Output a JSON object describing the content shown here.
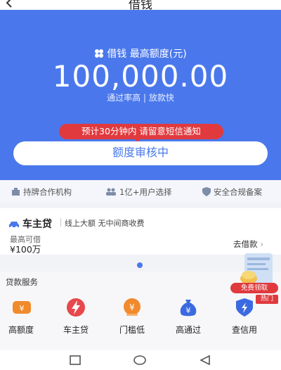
{
  "header": {
    "title": "借钱",
    "back_icon": "chevron-left-icon"
  },
  "hero": {
    "subtitle": "借钱 最高额度(元)",
    "amount": "100,000.00",
    "tagline": "通过率高 | 放款快",
    "notice": "预计30分钟内 请留意短信通知",
    "review_button": "额度审核中",
    "bg_color": "#4a78ec"
  },
  "features": [
    {
      "icon": "building-icon",
      "label": "持牌合作机构"
    },
    {
      "icon": "users-icon",
      "label": "1亿+用户选择"
    },
    {
      "icon": "shield-icon",
      "label": "安全合规备案"
    }
  ],
  "product_card": {
    "title": "车主贷",
    "desc": "线上大额 无中间商收费",
    "limit_label": "最高可借",
    "limit_value": "¥100万",
    "action": "去借款"
  },
  "services": {
    "title": "贷款服务",
    "items": [
      {
        "icon": "yuan-card-icon",
        "label": "高额度"
      },
      {
        "icon": "lightning-icon",
        "label": "车主贷"
      },
      {
        "icon": "yuan-circle-icon",
        "label": "门槛低"
      },
      {
        "icon": "money-bag-icon",
        "label": "高通过"
      },
      {
        "icon": "shield-lightning-icon",
        "label": "查信用"
      }
    ]
  },
  "promo": {
    "button": "免费领取",
    "badge": "热门"
  },
  "accent_red": "#e03a3e"
}
